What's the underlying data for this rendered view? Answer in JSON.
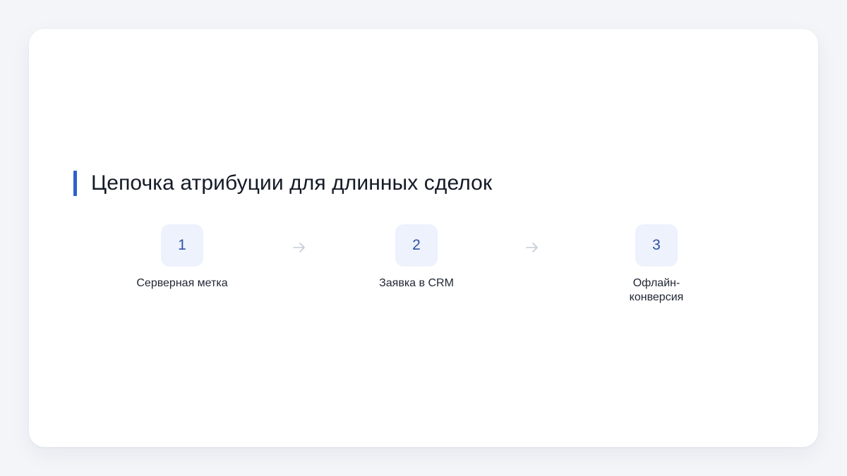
{
  "title": "Цепочка атрибуции для длинных сделок",
  "steps": [
    {
      "number": "1",
      "label": "Серверная метка"
    },
    {
      "number": "2",
      "label": "Заявка в CRM"
    },
    {
      "number": "3",
      "label": "Офлайн-конверсия"
    }
  ],
  "colors": {
    "accent": "#2f5fd1",
    "badge_bg": "#edf2fc",
    "badge_text": "#2f52a8",
    "arrow": "#c6cbd6"
  },
  "icons": {
    "connector": "arrow-right-icon"
  }
}
